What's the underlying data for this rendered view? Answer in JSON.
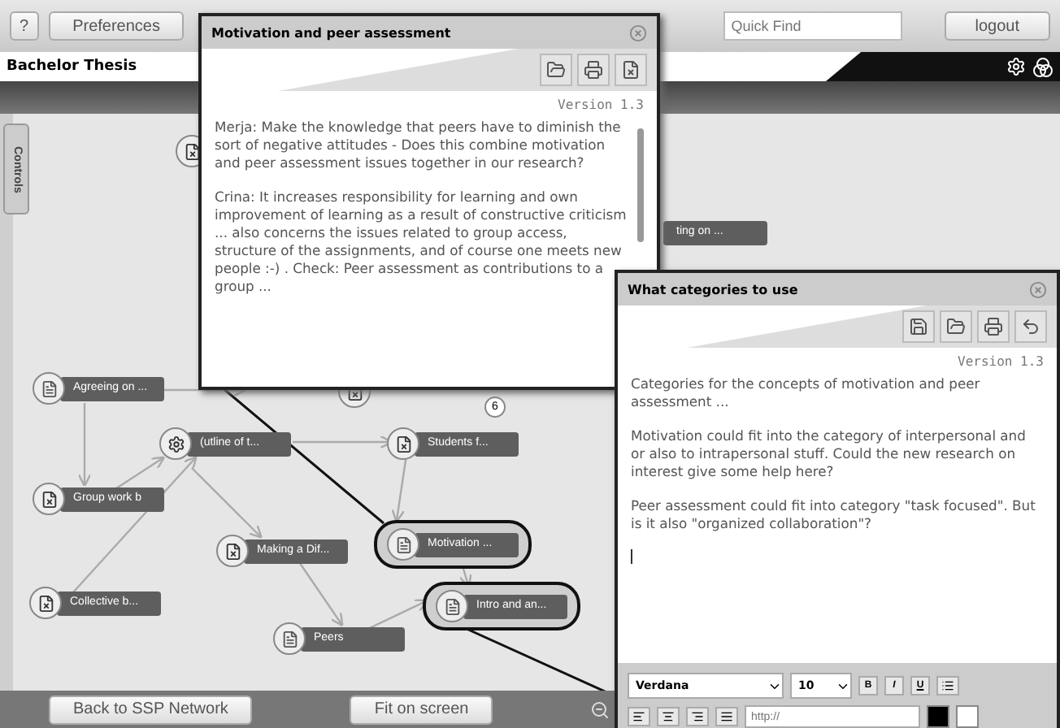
{
  "toolbar": {
    "help": "?",
    "buttons": [
      "Preferences"
    ],
    "quick_find": {
      "placeholder": "Quick Find"
    },
    "logout": "logout"
  },
  "project_title": "Bachelor Thesis",
  "controls_tab": "Controls",
  "map": {
    "nodes": [
      {
        "kind": "crossed",
        "highlighted": false
      },
      {
        "label": "ting on ...",
        "highlighted": false
      },
      {
        "label": "Agreeing on ...",
        "kind": "document",
        "highlighted": false
      },
      {
        "kind": "crossed",
        "highlighted": false
      },
      {
        "label": "(utline of t...",
        "kind": "outline",
        "highlighted": false
      },
      {
        "label": "Students f...",
        "kind": "crossed",
        "highlighted": false
      },
      {
        "label": "Group work b",
        "kind": "crossed",
        "highlighted": false
      },
      {
        "label": "Making a Dif...",
        "kind": "crossed",
        "highlighted": false
      },
      {
        "label": "Motivation ...",
        "kind": "document",
        "highlighted": true
      },
      {
        "label": "Collective b...",
        "kind": "crossed",
        "highlighted": false
      },
      {
        "label": "Intro and an...",
        "kind": "document",
        "highlighted": true
      },
      {
        "label": "Peers",
        "kind": "document",
        "highlighted": false
      }
    ],
    "comment_count": "6"
  },
  "dialogs": [
    {
      "title": "Motivation and peer assessment",
      "tools": [
        {
          "kind": "open"
        },
        {
          "kind": "print"
        },
        {
          "kind": "discard"
        }
      ],
      "version": "Version 1.3",
      "paragraphs": [
        "Merja: Make the knowledge that peers have to diminish the sort of negative attitudes - Does this combine motivation and peer assessment issues together in our research?",
        "Crina: It increases responsibility for learning and own improvement of learning as a result of constructive criticism ... also concerns the issues related to group access, structure of the assignments, and of course one meets new people :-) . Check: Peer assessment as contributions to a group ..."
      ]
    },
    {
      "title": "What categories to use",
      "tools": [
        {
          "kind": "save"
        },
        {
          "kind": "open"
        },
        {
          "kind": "print"
        },
        {
          "kind": "undo"
        }
      ],
      "version": "Version 1.3",
      "paragraphs": [
        "Categories for the concepts of motivation and peer assessment ...",
        "Motivation could fit into the category of interpersonal and or also to intrapersonal stuff. Could the  new research on interest give some help here?",
        "Peer assessment could fit into category \"task focused\". But is it also \"organized collaboration\"?"
      ],
      "font": "Verdana",
      "font_size": "10",
      "styles": [
        "B",
        "I",
        "U"
      ],
      "link_placeholder": "http://"
    }
  ],
  "bottom_bar": {
    "back": "Back to SSP Network",
    "fit": "Fit on screen"
  }
}
